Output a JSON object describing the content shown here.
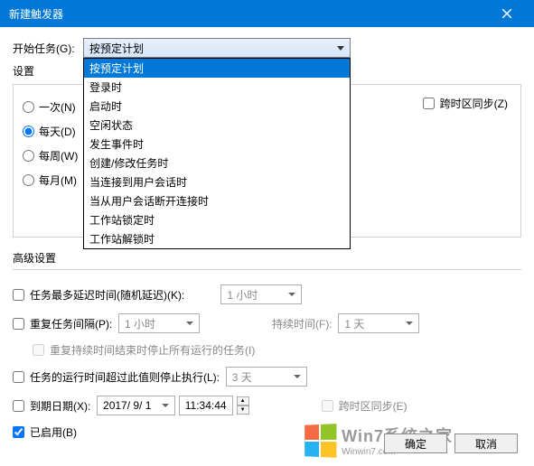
{
  "title": "新建触发器",
  "start_task_label": "开始任务(G):",
  "settings_label": "设置",
  "combo_selected": "按预定计划",
  "combo_options": [
    "按预定计划",
    "登录时",
    "启动时",
    "空闲状态",
    "发生事件时",
    "创建/修改任务时",
    "当连接到用户会话时",
    "当从用户会话断开连接时",
    "工作站锁定时",
    "工作站解锁时"
  ],
  "radios": {
    "once": "一次(N)",
    "daily": "每天(D)",
    "weekly": "每周(W)",
    "monthly": "每月(M)"
  },
  "right_panel": {
    "sync_tz": "跨时区同步(Z)"
  },
  "adv_label": "高级设置",
  "adv": {
    "delay_label": "任务最多延迟时间(随机延迟)(K):",
    "delay_value": "1 小时",
    "repeat_label": "重复任务间隔(P):",
    "repeat_value": "1 小时",
    "duration_label": "持续时间(F):",
    "duration_value": "1 天",
    "stop_running_label": "重复持续时间结束时停止所有运行的任务(I)",
    "stop_if_longer_label": "任务的运行时间超过此值则停止执行(L):",
    "stop_if_longer_value": "3 天",
    "expire_label": "到期日期(X):",
    "expire_date": "2017/ 9/ 1",
    "expire_time": "11:34:44",
    "expire_sync_tz": "跨时区同步(E)",
    "enabled_label": "已启用(B)"
  },
  "buttons": {
    "ok": "确定",
    "cancel": "取消"
  },
  "watermark": {
    "main": "Win7系统之家",
    "sub": "Winwin7.com"
  }
}
